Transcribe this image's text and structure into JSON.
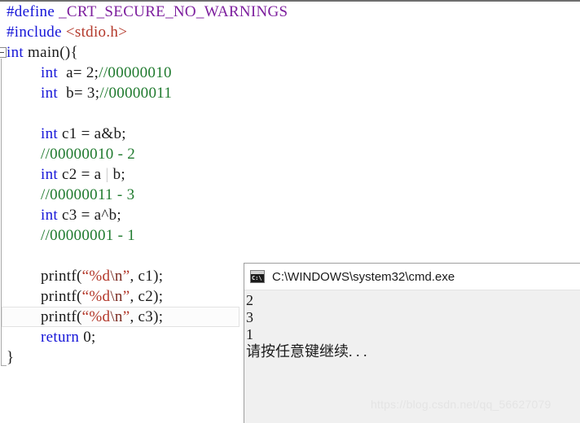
{
  "editor": {
    "name": "code-editor",
    "language": "c",
    "current_line_index": 15,
    "colors": {
      "background": "#ffffff",
      "keyword": "#1616d8",
      "preprocessor": "#1616d8",
      "macro_name": "#7d1f9e",
      "header_name": "#b3382a",
      "comment": "#1f7a2e",
      "string": "#b3382a",
      "plain_text": "#1a1a1a",
      "dimmed_operator": "#c9c9c9",
      "current_line_border": "#e2e2e2"
    },
    "lines": [
      {
        "indent": 0,
        "tokens": [
          {
            "t": "#define ",
            "c": "pp"
          },
          {
            "t": "_CRT_SECURE_NO_WARNINGS",
            "c": "macro"
          }
        ]
      },
      {
        "indent": 0,
        "tokens": [
          {
            "t": "#include ",
            "c": "pp"
          },
          {
            "t": "<stdio.h>",
            "c": "hdr"
          }
        ]
      },
      {
        "indent": 0,
        "tokens": [
          {
            "t": "int",
            "c": "kw"
          },
          {
            "t": " main(){",
            "c": "punc"
          }
        ]
      },
      {
        "indent": 2,
        "tokens": [
          {
            "t": "int",
            "c": "kw"
          },
          {
            "t": "  a= 2;",
            "c": "punc"
          },
          {
            "t": "//00000010",
            "c": "cmt"
          }
        ]
      },
      {
        "indent": 2,
        "tokens": [
          {
            "t": "int",
            "c": "kw"
          },
          {
            "t": "  b= 3;",
            "c": "punc"
          },
          {
            "t": "//00000011",
            "c": "cmt"
          }
        ]
      },
      {
        "indent": 0,
        "tokens": []
      },
      {
        "indent": 2,
        "tokens": [
          {
            "t": "int",
            "c": "kw"
          },
          {
            "t": " c1 = a&b;",
            "c": "punc"
          }
        ]
      },
      {
        "indent": 2,
        "tokens": [
          {
            "t": "//00000010 - 2",
            "c": "cmt"
          }
        ]
      },
      {
        "indent": 2,
        "tokens": [
          {
            "t": "int",
            "c": "kw"
          },
          {
            "t": " c2 = a ",
            "c": "punc"
          },
          {
            "t": "|",
            "c": "op-dim"
          },
          {
            "t": " b;",
            "c": "punc"
          }
        ]
      },
      {
        "indent": 2,
        "tokens": [
          {
            "t": "//00000011 - 3",
            "c": "cmt"
          }
        ]
      },
      {
        "indent": 2,
        "tokens": [
          {
            "t": "int",
            "c": "kw"
          },
          {
            "t": " c3 = a^b;",
            "c": "punc"
          }
        ]
      },
      {
        "indent": 2,
        "tokens": [
          {
            "t": "//00000001 - 1",
            "c": "cmt"
          }
        ]
      },
      {
        "indent": 0,
        "tokens": []
      },
      {
        "indent": 2,
        "tokens": [
          {
            "t": "printf(",
            "c": "punc"
          },
          {
            "t": "“%d",
            "c": "str"
          },
          {
            "t": "\\n",
            "c": "esc"
          },
          {
            "t": "”",
            "c": "str"
          },
          {
            "t": ", c1);",
            "c": "punc"
          }
        ]
      },
      {
        "indent": 2,
        "tokens": [
          {
            "t": "printf(",
            "c": "punc"
          },
          {
            "t": "“%d",
            "c": "str"
          },
          {
            "t": "\\n",
            "c": "esc"
          },
          {
            "t": "”",
            "c": "str"
          },
          {
            "t": ", c2);",
            "c": "punc"
          }
        ]
      },
      {
        "indent": 2,
        "tokens": [
          {
            "t": "printf(",
            "c": "punc"
          },
          {
            "t": "“%d",
            "c": "str"
          },
          {
            "t": "\\n",
            "c": "esc"
          },
          {
            "t": "”",
            "c": "str"
          },
          {
            "t": ", c3);",
            "c": "punc"
          }
        ]
      },
      {
        "indent": 2,
        "tokens": [
          {
            "t": "return",
            "c": "kw"
          },
          {
            "t": " 0;",
            "c": "punc"
          }
        ]
      },
      {
        "indent": 0,
        "tokens": [
          {
            "t": "}",
            "c": "punc"
          }
        ]
      }
    ]
  },
  "console": {
    "title": "C:\\WINDOWS\\system32\\cmd.exe",
    "icon": "cmd-exe-icon",
    "icon_prompt_text": "C:\\",
    "output": [
      "2",
      "3",
      "1",
      "请按任意键继续. . ."
    ]
  },
  "watermark": {
    "text": "https://blog.csdn.net/qq_56627079"
  }
}
